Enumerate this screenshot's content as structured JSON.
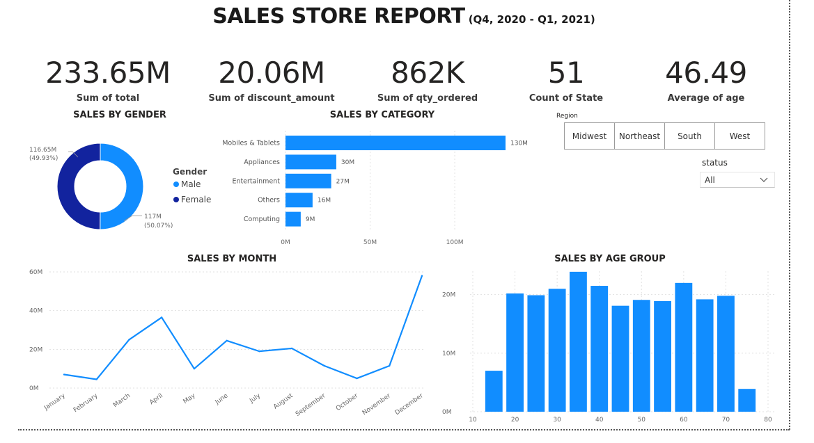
{
  "header": {
    "title": "SALES STORE REPORT",
    "subtitle": "(Q4, 2020 - Q1, 2021)"
  },
  "kpis": [
    {
      "value": "233.65M",
      "label": "Sum of total"
    },
    {
      "value": "20.06M",
      "label": "Sum of discount_amount"
    },
    {
      "value": "862K",
      "label": "Sum of qty_ordered"
    },
    {
      "value": "51",
      "label": "Count of State"
    },
    {
      "value": "46.49",
      "label": "Average of age"
    }
  ],
  "gender_chart": {
    "title": "SALES BY GENDER",
    "legend_title": "Gender",
    "colors": {
      "Male": "#118DFF",
      "Female": "#12239E"
    },
    "labels": {
      "female_value": "116.65M",
      "female_pct": "(49.93%)",
      "male_value": "117M",
      "male_pct": "(50.07%)"
    }
  },
  "category_chart": {
    "title": "SALES BY CATEGORY"
  },
  "month_chart": {
    "title": "SALES BY MONTH"
  },
  "age_chart": {
    "title": "SALES BY AGE GROUP"
  },
  "slicers": {
    "region_label": "Region",
    "regions": [
      "Midwest",
      "Northeast",
      "South",
      "West"
    ],
    "status_label": "status",
    "status_value": "All"
  },
  "chart_data": [
    {
      "type": "pie",
      "title": "SALES BY GENDER",
      "categories": [
        "Male",
        "Female"
      ],
      "values": [
        117.0,
        116.65
      ],
      "unit": "M"
    },
    {
      "type": "bar",
      "orientation": "horizontal",
      "title": "SALES BY CATEGORY",
      "categories": [
        "Mobiles & Tablets",
        "Appliances",
        "Entertainment",
        "Others",
        "Computing"
      ],
      "values": [
        130,
        30,
        27,
        16,
        9
      ],
      "data_labels": [
        "130M",
        "30M",
        "27M",
        "16M",
        "9M"
      ],
      "xlim": [
        0,
        130
      ],
      "xticks": [
        0,
        50,
        100
      ],
      "xtick_labels": [
        "0M",
        "50M",
        "100M"
      ],
      "grid": true
    },
    {
      "type": "line",
      "title": "SALES BY MONTH",
      "categories": [
        "January",
        "February",
        "March",
        "April",
        "May",
        "June",
        "July",
        "August",
        "September",
        "October",
        "November",
        "December"
      ],
      "values": [
        7,
        4.5,
        25,
        36.5,
        10,
        24.5,
        19,
        20.5,
        11.5,
        5,
        11.5,
        58
      ],
      "ylim": [
        0,
        60
      ],
      "yticks": [
        0,
        20,
        40,
        60
      ],
      "ytick_labels": [
        "0M",
        "20M",
        "40M",
        "60M"
      ],
      "grid": true,
      "color": "#118DFF"
    },
    {
      "type": "bar",
      "title": "SALES BY AGE GROUP",
      "x": [
        15,
        20,
        25,
        30,
        35,
        40,
        45,
        50,
        55,
        60,
        65,
        70,
        75
      ],
      "values": [
        7,
        20.2,
        19.9,
        21,
        23.9,
        21.5,
        18.1,
        19.1,
        18.9,
        22,
        19.2,
        19.8,
        3.9
      ],
      "xlim": [
        10,
        80
      ],
      "xticks": [
        10,
        20,
        30,
        40,
        50,
        60,
        70,
        80
      ],
      "ylim": [
        0,
        24
      ],
      "yticks": [
        0,
        10,
        20
      ],
      "ytick_labels": [
        "0M",
        "10M",
        "20M"
      ],
      "grid": true,
      "color": "#118DFF"
    }
  ]
}
